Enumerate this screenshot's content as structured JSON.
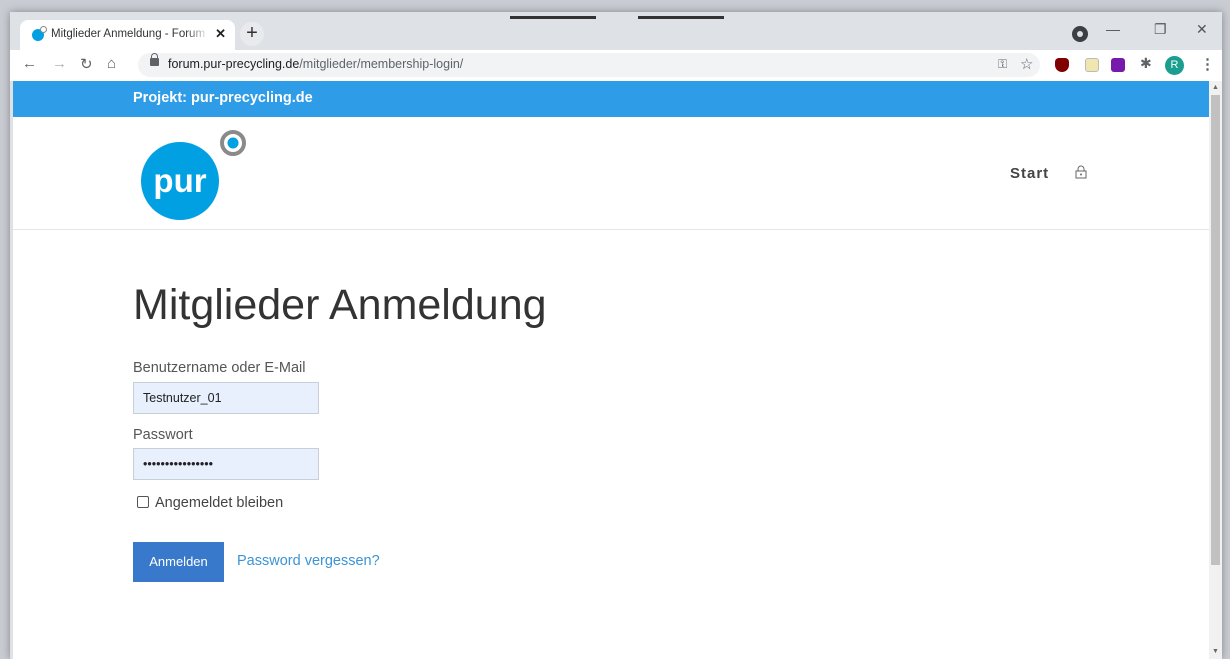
{
  "browser": {
    "tab_title": "Mitglieder Anmeldung - Forum P",
    "tab_close": "✕",
    "new_tab": "+",
    "url_host": "forum.pur-precycling.de",
    "url_path": "/mitglieder/membership-login/",
    "avatar_letter": "R",
    "icons": [
      "back-icon",
      "forward-icon",
      "reload-icon",
      "home-icon",
      "lock-icon",
      "key-icon",
      "star-icon",
      "ublock-icon",
      "notes-icon",
      "onenote-icon",
      "extensions-icon",
      "menu-icon"
    ]
  },
  "site": {
    "topbar_text": "Projekt: pur-precycling.de",
    "nav_start": "Start",
    "logo_text": "pur",
    "brand_color": "#2f9ce8",
    "logo_color": "#00a0e3"
  },
  "login": {
    "title": "Mitglieder Anmeldung",
    "username_label": "Benutzername oder E-Mail",
    "username_value": "Testnutzer_01",
    "password_label": "Passwort",
    "password_value": "••••••••••••••••",
    "remember_label": "Angemeldet bleiben",
    "submit_label": "Anmelden",
    "forgot_label": "Password vergessen?",
    "button_color": "#3879cb"
  }
}
